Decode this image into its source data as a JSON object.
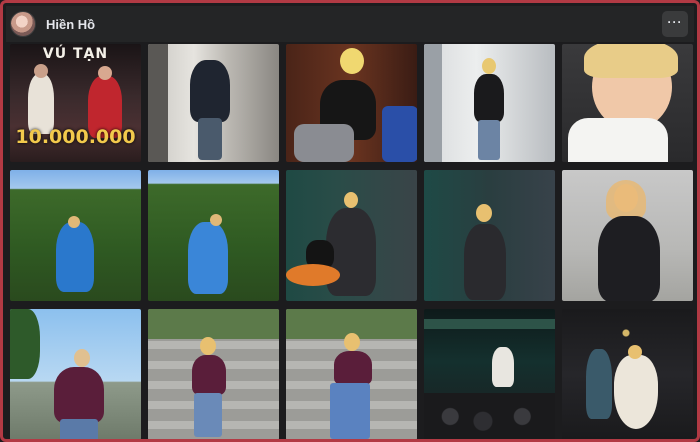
{
  "header": {
    "title": "Hiền Hồ",
    "more_label": "···"
  },
  "photos": [
    {
      "caption_top": "VÚ TẠN",
      "caption_bottom": "10.000.000",
      "icon": "music-video-thumbnail"
    },
    {
      "icon": "photo-thumbnail"
    },
    {
      "icon": "photo-thumbnail"
    },
    {
      "icon": "photo-thumbnail"
    },
    {
      "icon": "photo-thumbnail"
    },
    {
      "icon": "photo-thumbnail"
    },
    {
      "icon": "photo-thumbnail"
    },
    {
      "icon": "photo-thumbnail"
    },
    {
      "icon": "photo-thumbnail"
    },
    {
      "icon": "photo-thumbnail"
    },
    {
      "icon": "photo-thumbnail"
    },
    {
      "icon": "photo-thumbnail"
    },
    {
      "icon": "photo-thumbnail"
    },
    {
      "icon": "photo-thumbnail"
    },
    {
      "icon": "photo-thumbnail"
    }
  ],
  "colors": {
    "border": "#b23a44",
    "header_bg": "#242526",
    "page_bg": "#1c1c1e",
    "text": "#e4e6eb"
  }
}
